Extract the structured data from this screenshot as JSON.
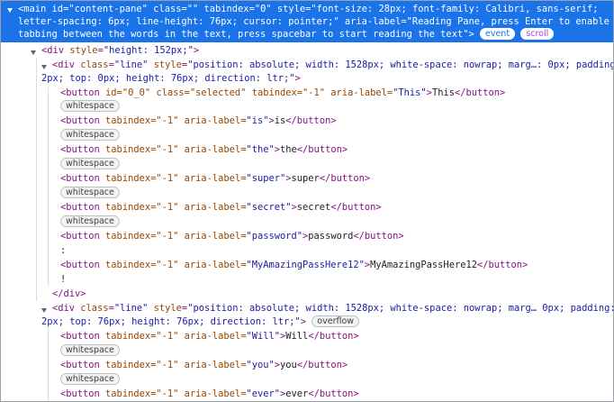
{
  "elements_panel": {
    "main_node": {
      "line1": {
        "open": "<main ",
        "id_attr": "id",
        "id_val": "\"content-pane\"",
        "class_attr": " class",
        "class_val": "\"\"",
        "tabindex_attr": " tabindex",
        "tabindex_val": "\"0\"",
        "style_attr": " style",
        "style_val": "\"font-size: 28px; font-family: Calibri, sans-serif;"
      },
      "line2": "letter-spacing: 6px; line-height: 76px; cursor: pointer;\" aria-label=\"Reading Pane, press Enter to enable",
      "line3": "tabbing between the words in the text, press spacebar to start reading the text\">",
      "badge_event": "event",
      "badge_scroll": "scroll"
    },
    "nodes": {
      "div_height": {
        "open": "<div ",
        "attr": "style",
        "val": "\"height: 152px;\"",
        "close": ">"
      },
      "line1": {
        "open": "<div ",
        "class_attr": "class",
        "class_val": "\"line\"",
        "style_attr": " style",
        "style_val": "\"position: absolute; width: 1528px; white-space: nowrap; marg…: 0px; padding:",
        "cont": "2px; top: 0px; height: 76px; direction: ltr;\"",
        "cont_close": ">"
      },
      "buttons1": [
        {
          "open": "<button ",
          "pre_attrs": "id=\"0_0\" class=\"selected\" ",
          "tabindex": "tabindex=\"-1\" ",
          "aria": "aria-label=",
          "label": "\"This\"",
          "gt": ">",
          "text": "This",
          "close": "</button>"
        },
        {
          "open": "<button ",
          "pre_attrs": "",
          "tabindex": "tabindex=\"-1\" ",
          "aria": "aria-label=",
          "label": "\"is\"",
          "gt": ">",
          "text": "is",
          "close": "</button>"
        },
        {
          "open": "<button ",
          "pre_attrs": "",
          "tabindex": "tabindex=\"-1\" ",
          "aria": "aria-label=",
          "label": "\"the\"",
          "gt": ">",
          "text": "the",
          "close": "</button>"
        },
        {
          "open": "<button ",
          "pre_attrs": "",
          "tabindex": "tabindex=\"-1\" ",
          "aria": "aria-label=",
          "label": "\"super\"",
          "gt": ">",
          "text": "super",
          "close": "</button>"
        },
        {
          "open": "<button ",
          "pre_attrs": "",
          "tabindex": "tabindex=\"-1\" ",
          "aria": "aria-label=",
          "label": "\"secret\"",
          "gt": ">",
          "text": "secret",
          "close": "</button>"
        },
        {
          "open": "<button ",
          "pre_attrs": "",
          "tabindex": "tabindex=\"-1\" ",
          "aria": "aria-label=",
          "label": "\"password\"",
          "gt": ">",
          "text": "password",
          "close": "</button>"
        },
        {
          "open": "<button ",
          "pre_attrs": "",
          "tabindex": "tabindex=\"-1\" ",
          "aria": "aria-label=",
          "label": "\"MyAmazingPassHere12\"",
          "gt": ">",
          "text": "MyAmazingPassHere12",
          "close": "</button>"
        }
      ],
      "whitespace_badge": "whitespace",
      "colon_text": ":",
      "bang_text": "!",
      "div_close": "</div>",
      "line2": {
        "open": "<div ",
        "class_attr": "class",
        "class_val": "\"line\"",
        "style_attr": " style",
        "style_val": "\"position: absolute; width: 1528px; white-space: nowrap; marg… 0px; padding:",
        "cont": "2px; top: 76px; height: 76px; direction: ltr;\"",
        "cont_close": ">",
        "overflow_badge": "overflow"
      },
      "buttons2": [
        {
          "open": "<button ",
          "tabindex": "tabindex=\"-1\" ",
          "aria": "aria-label=",
          "label": "\"Will\"",
          "gt": ">",
          "text": "Will",
          "close": "</button>"
        },
        {
          "open": "<button ",
          "tabindex": "tabindex=\"-1\" ",
          "aria": "aria-label=",
          "label": "\"you\"",
          "gt": ">",
          "text": "you",
          "close": "</button>"
        },
        {
          "open": "<button ",
          "tabindex": "tabindex=\"-1\" ",
          "aria": "aria-label=",
          "label": "\"ever\"",
          "gt": ">",
          "text": "ever",
          "close": "</button>"
        }
      ]
    }
  }
}
